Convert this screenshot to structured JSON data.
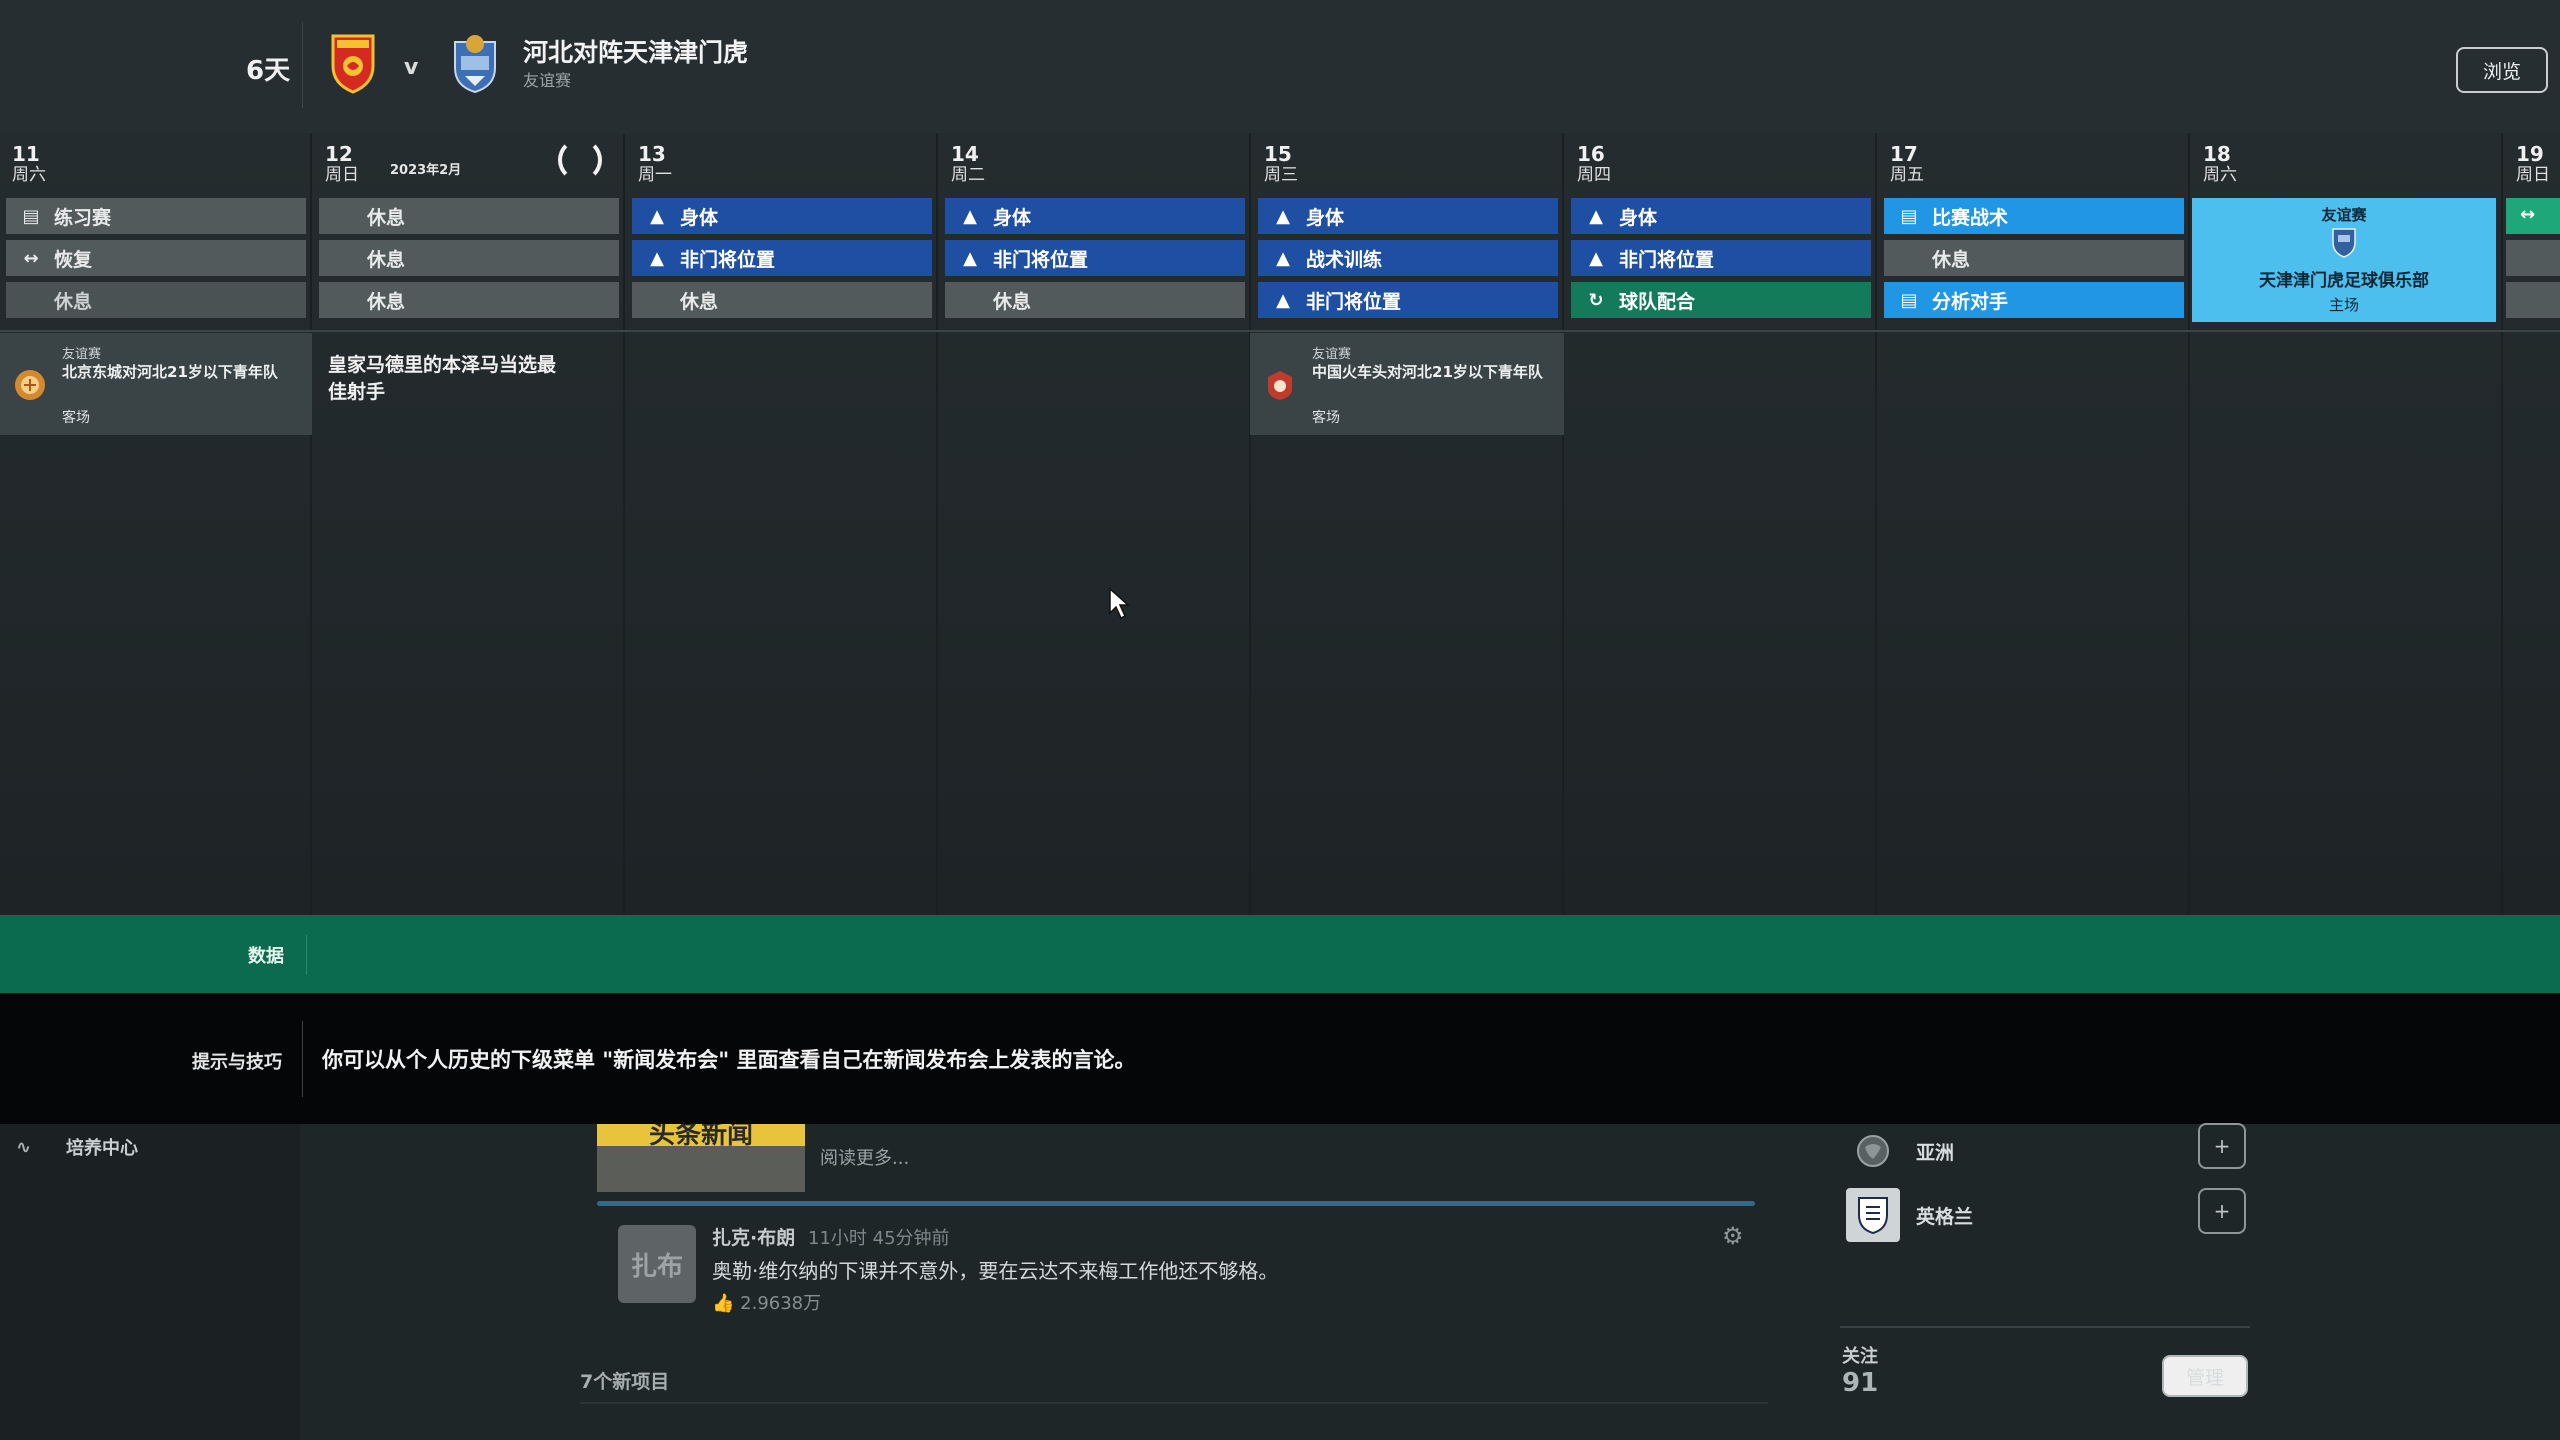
{
  "header": {
    "days_left": "6天",
    "vs": "v",
    "title": "河北对阵天津津门虎",
    "subtitle": "友谊赛",
    "browse_label": "浏览",
    "home_crest": "hebei-crest-icon",
    "away_crest": "tianjin-crest-icon"
  },
  "calendar": {
    "month_label": "2023年2月",
    "days": [
      {
        "num": "11",
        "weekday": "周六"
      },
      {
        "num": "12",
        "weekday": "周日"
      },
      {
        "num": "13",
        "weekday": "周一"
      },
      {
        "num": "14",
        "weekday": "周二"
      },
      {
        "num": "15",
        "weekday": "周三"
      },
      {
        "num": "16",
        "weekday": "周四"
      },
      {
        "num": "17",
        "weekday": "周五"
      },
      {
        "num": "18",
        "weekday": "周六"
      },
      {
        "num": "19",
        "weekday": "周日"
      }
    ],
    "sessions": {
      "d11": [
        "练习赛",
        "恢复",
        "休息"
      ],
      "d12": [
        "休息",
        "休息",
        "休息"
      ],
      "d13": [
        "身体",
        "非门将位置",
        "休息"
      ],
      "d14": [
        "身体",
        "非门将位置",
        "休息"
      ],
      "d15": [
        "身体",
        "战术训练",
        "非门将位置"
      ],
      "d16": [
        "身体",
        "非门将位置",
        "球队配合"
      ],
      "d17": [
        "比赛战术",
        "休息",
        "分析对手"
      ]
    },
    "match_11": {
      "tag": "友谊赛",
      "title": "北京东城对河北21岁以下青年队",
      "venue": "客场"
    },
    "news_12": "皇家马德里的本泽马当选最佳射手",
    "match_15": {
      "tag": "友谊赛",
      "title": "中国火车头对河北21岁以下青年队",
      "venue": "客场"
    },
    "match_18": {
      "tag": "友谊赛",
      "team": "天津津门虎足球俱乐部",
      "venue": "主场"
    },
    "colors": {
      "blue": "#1e4fa2",
      "light_blue": "#2196e4",
      "green": "#137a5a",
      "grey": "#525a5c",
      "match_highlight": "#4cbfee"
    }
  },
  "data_bar": {
    "label": "数据"
  },
  "tips": {
    "label": "提示与技巧",
    "text": "你可以从个人历史的下级菜单 \"新闻发布会\" 里面查看自己在新闻发布会上发表的言论。"
  },
  "bottom": {
    "sidebar_item": "培养中心",
    "news_thumb_text": "头条新闻",
    "read_more": "阅读更多...",
    "post": {
      "avatar_text": "扎布",
      "author": "扎克·布朗",
      "time": "11小时 45分钟前",
      "text": "奥勒·维尔纳的下课并不意外，要在云达不来梅工作他还不够格。",
      "likes": "2.9638万"
    },
    "new_items": "7个新项目",
    "follow": {
      "items": [
        {
          "name": "亚洲",
          "icon": "asia-globe-icon"
        },
        {
          "name": "英格兰",
          "icon": "england-crest-icon"
        }
      ],
      "label": "关注",
      "count": "91",
      "manage_label": "管理"
    }
  }
}
